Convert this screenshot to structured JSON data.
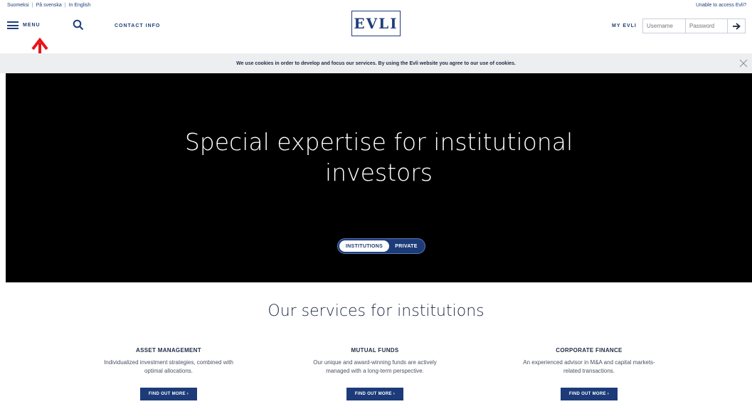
{
  "header": {
    "languages": [
      "Suomeksi",
      "På svenska",
      "In English"
    ],
    "lang_separator": "|",
    "unable_access": "Unable to access Evli?",
    "menu_label": "MENU",
    "contact_label": "CONTACT INFO",
    "logo_text": "EVLI",
    "my_evli_label": "MY EVLI",
    "username_placeholder": "Username",
    "password_placeholder": "Password"
  },
  "cookie": {
    "message": "We use cookies in order to develop and focus our services. By using the Evli website you agree to our use of cookies."
  },
  "hero": {
    "title_line1": "Special expertise for institutional",
    "title_line2": "investors",
    "toggle_active": "INSTITUTIONS",
    "toggle_inactive": "PRIVATE"
  },
  "services": {
    "title": "Our services for institutions",
    "items": [
      {
        "heading": "ASSET MANAGEMENT",
        "line1": "Individualized investment strategies, combined with",
        "line2": "optimal allocations.",
        "button": "FIND OUT MORE ›"
      },
      {
        "heading": "MUTUAL FUNDS",
        "line1": "Our unique and award-winning funds are actively",
        "line2": "managed with a long-term perspective.",
        "button": "FIND OUT MORE ›"
      },
      {
        "heading": "CORPORATE FINANCE",
        "line1": "An experienced advisor in M&A and capital markets-",
        "line2": "related transactions.",
        "button": "FIND OUT MORE ›"
      }
    ]
  },
  "colors": {
    "brand_blue": "#1c3b78",
    "annotation_red": "#e8141b",
    "hero_bg": "#000000",
    "cookie_bg": "#eceeef"
  }
}
